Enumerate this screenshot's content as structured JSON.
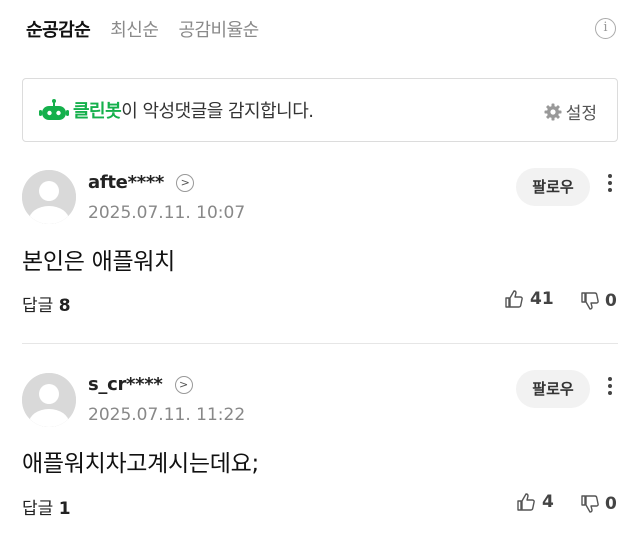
{
  "sort_tabs": [
    "순공감순",
    "최신순",
    "공감비율순"
  ],
  "info_icon": "info-icon",
  "cleanbot": {
    "brand": "클린봇",
    "text": "이 악성댓글을 감지합니다.",
    "settings_label": "설정"
  },
  "comments": [
    {
      "user": "afte****",
      "date": "2025.07.11. 10:07",
      "follow_label": "팔로우",
      "text": "본인은 애플워치",
      "reply_label": "답글",
      "reply_count": "8",
      "likes": "41",
      "dislikes": "0"
    },
    {
      "user": "s_cr****",
      "date": "2025.07.11. 11:22",
      "follow_label": "팔로우",
      "text": "애플워치차고계시는데요;",
      "reply_label": "답글",
      "reply_count": "1",
      "likes": "4",
      "dislikes": "0"
    }
  ],
  "colors": {
    "brand_green": "#15b04c"
  }
}
